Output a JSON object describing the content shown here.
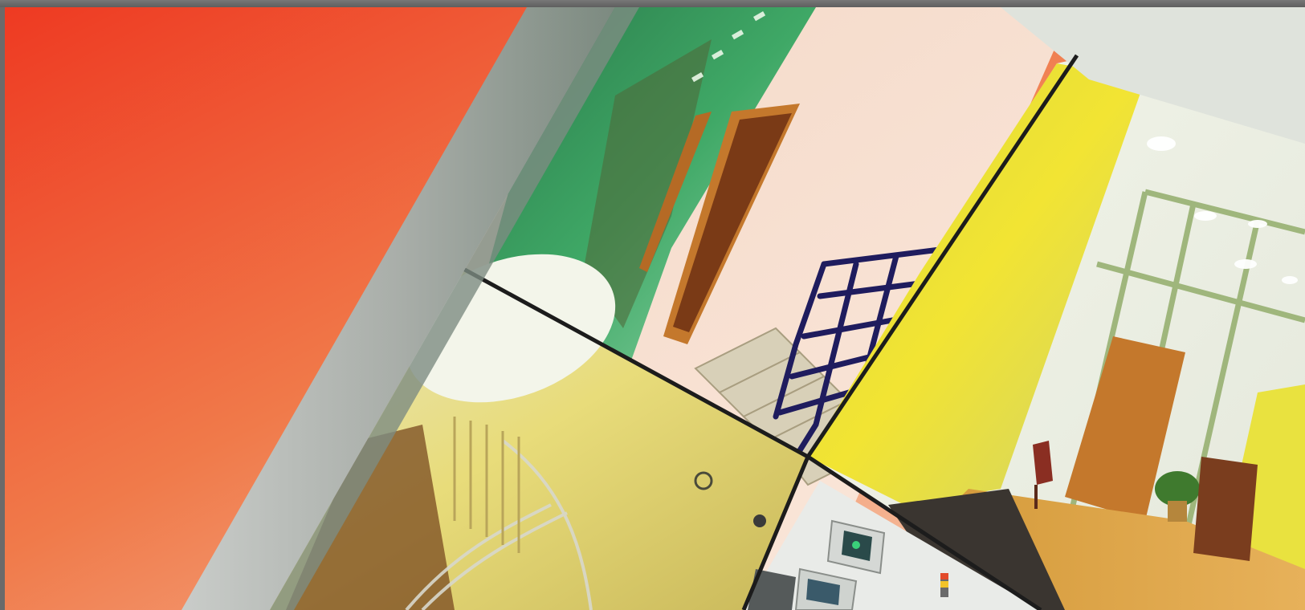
{
  "colors": {
    "frame": "#6a6a6a",
    "gradient_start": "#ee3a22",
    "gradient_end": "#f7d2b8",
    "frame_bar": "#b9bcb8",
    "corridor_green": "#2f8f55",
    "wall_pink": "#f7d9c6",
    "yellow_wall": "#e7e03a",
    "stair_rail": "#1f1c5e",
    "door_wood": "#c4782c",
    "glass_frame": "#9fb67c"
  },
  "panels": [
    {
      "name": "orange-gradient-panel"
    },
    {
      "name": "corridor-stairs-photo"
    },
    {
      "name": "glass-office-photo"
    },
    {
      "name": "spiral-stair-photo"
    },
    {
      "name": "control-room-photo"
    }
  ]
}
